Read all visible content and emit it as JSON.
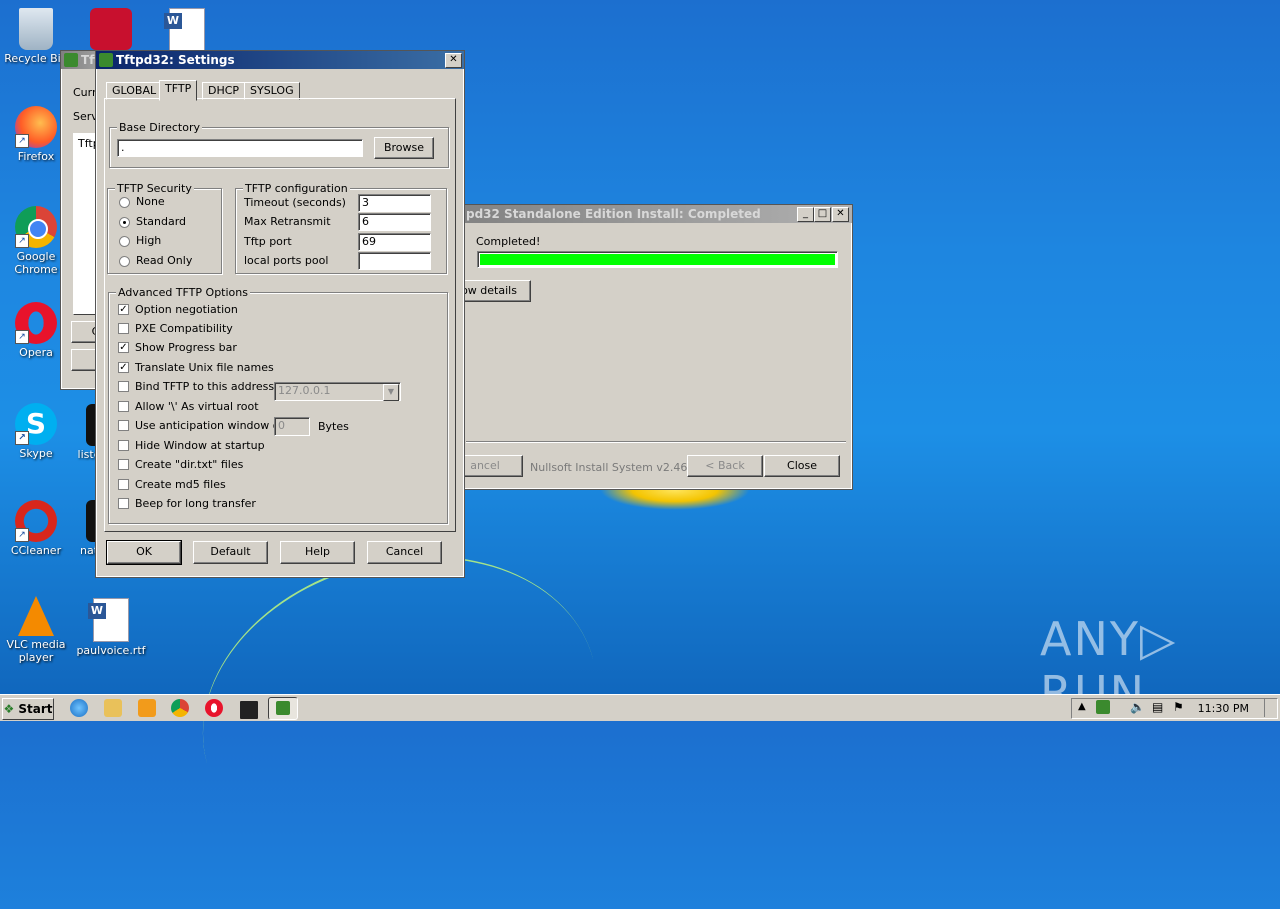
{
  "desktop_icons": [
    {
      "label": "Recycle Bin"
    },
    {
      "label": "Firefox"
    },
    {
      "label": "Google Chrome"
    },
    {
      "label": "Opera"
    },
    {
      "label": "Skype"
    },
    {
      "label": "CCleaner"
    },
    {
      "label": "VLC media player"
    },
    {
      "label": "paulvoice.rtf"
    },
    {
      "label": "liste"
    },
    {
      "label": "nat"
    }
  ],
  "back_window": {
    "title": "Tft",
    "labels": [
      "Curre",
      "Serv",
      "Tftp"
    ],
    "button_label": "Cl"
  },
  "installer": {
    "title": "pd32 Standalone Edition Install: Completed",
    "status": "Completed!",
    "progress": 1.0,
    "progress_color": "#00ff00",
    "show_details": "ow details",
    "cancel": "ancel",
    "brand": "Nullsoft Install System v2.46",
    "back": "< Back",
    "close": "Close"
  },
  "settings": {
    "title": "Tftpd32: Settings",
    "tabs": [
      "GLOBAL",
      "TFTP",
      "DHCP",
      "SYSLOG"
    ],
    "active_tab": "TFTP",
    "base_dir": {
      "legend": "Base Directory",
      "value": ".",
      "browse": "Browse"
    },
    "security": {
      "legend": "TFTP Security",
      "options": [
        "None",
        "Standard",
        "High",
        "Read Only"
      ],
      "selected": "Standard"
    },
    "config": {
      "legend": "TFTP configuration",
      "fields": [
        {
          "label": "Timeout (seconds)",
          "value": "3"
        },
        {
          "label": "Max Retransmit",
          "value": "6"
        },
        {
          "label": "Tftp port",
          "value": "69"
        },
        {
          "label": "local ports pool",
          "value": ""
        }
      ]
    },
    "advanced": {
      "legend": "Advanced TFTP Options",
      "options": [
        {
          "label": "Option negotiation",
          "checked": true
        },
        {
          "label": "PXE Compatibility",
          "checked": false
        },
        {
          "label": "Show Progress bar",
          "checked": true
        },
        {
          "label": "Translate Unix file names",
          "checked": true
        },
        {
          "label": "Bind TFTP to this address",
          "checked": false
        },
        {
          "label": "Allow '\\' As virtual root",
          "checked": false
        },
        {
          "label": "Use anticipation window of",
          "checked": false
        },
        {
          "label": "Hide Window at startup",
          "checked": false
        },
        {
          "label": "Create \"dir.txt\" files",
          "checked": false
        },
        {
          "label": "Create md5 files",
          "checked": false
        },
        {
          "label": "Beep for long transfer",
          "checked": false
        }
      ],
      "bind_address": "127.0.0.1",
      "anticipation_value": "0",
      "bytes_label": "Bytes"
    },
    "buttons": {
      "ok": "OK",
      "default": "Default",
      "help": "Help",
      "cancel": "Cancel"
    }
  },
  "taskbar": {
    "start": "Start",
    "clock": "11:30 PM"
  },
  "watermark": {
    "left": "ANY",
    "right": "RUN"
  }
}
